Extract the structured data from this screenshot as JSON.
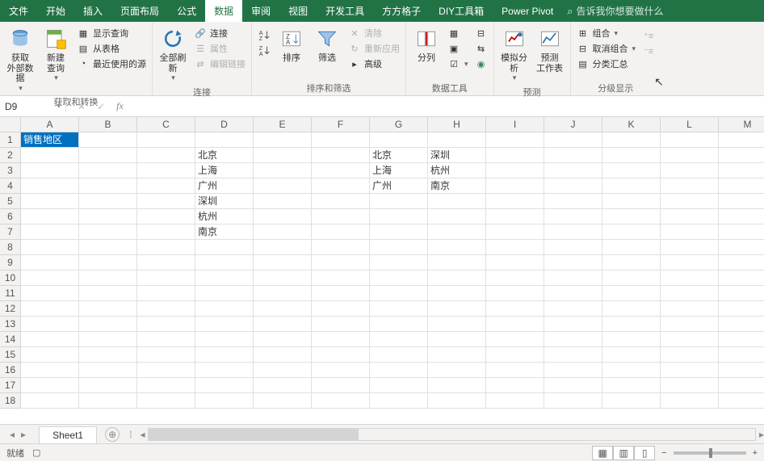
{
  "tabs": {
    "file": "文件",
    "home": "开始",
    "insert": "插入",
    "layout": "页面布局",
    "formula": "公式",
    "data": "数据",
    "review": "审阅",
    "view": "视图",
    "dev": "开发工具",
    "fang": "方方格子",
    "diy": "DIY工具箱",
    "pp": "Power Pivot",
    "tellme": "告诉我你想要做什么"
  },
  "ribbon": {
    "g1": {
      "label": "获取和转换",
      "ext": "获取\n外部数据",
      "new": "新建\n查询",
      "c1": "显示查询",
      "c2": "从表格",
      "c3": "最近使用的源"
    },
    "g2": {
      "label": "连接",
      "refresh": "全部刷新",
      "c1": "连接",
      "c2": "属性",
      "c3": "编辑链接"
    },
    "g3": {
      "label": "排序和筛选",
      "sort": "排序",
      "filter": "筛选",
      "c1": "清除",
      "c2": "重新应用",
      "c3": "高级"
    },
    "g4": {
      "label": "数据工具",
      "split": "分列"
    },
    "g5": {
      "label": "预测",
      "sim": "模拟分析",
      "fc": "预测\n工作表"
    },
    "g6": {
      "label": "分级显示",
      "c1": "组合",
      "c2": "取消组合",
      "c3": "分类汇总"
    }
  },
  "name_box": "D9",
  "sheet": {
    "cols": [
      "A",
      "B",
      "C",
      "D",
      "E",
      "F",
      "G",
      "H",
      "I",
      "J",
      "K",
      "L",
      "M"
    ],
    "rows": [
      "1",
      "2",
      "3",
      "4",
      "5",
      "6",
      "7",
      "8",
      "9",
      "10",
      "11",
      "12",
      "13",
      "14",
      "15",
      "16",
      "17",
      "18"
    ],
    "cells": {
      "A1": "销售地区",
      "D2": "北京",
      "D3": "上海",
      "D4": "广州",
      "D5": "深圳",
      "D6": "杭州",
      "D7": "南京",
      "G2": "北京",
      "G3": "上海",
      "G4": "广州",
      "H2": "深圳",
      "H3": "杭州",
      "H4": "南京"
    },
    "tab": "Sheet1"
  },
  "status": {
    "ready": "就绪",
    "zoom": "+"
  }
}
